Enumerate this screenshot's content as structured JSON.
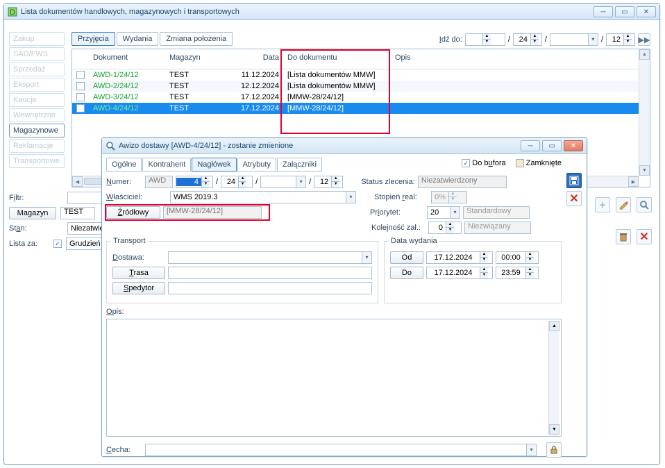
{
  "main": {
    "title": "Lista dokumentów handlowych, magazynowych i transportowych",
    "sidetabs": [
      "Zakup",
      "SAD/FWS",
      "Sprzedaż",
      "Eksport",
      "Kaucje",
      "Wewnętrzne",
      "Magazynowe",
      "Reklamacje",
      "Transportowe"
    ],
    "sidetab_active_index": 6,
    "toptabs": [
      "Przyjęcia",
      "Wydania",
      "Zmiana położenia"
    ],
    "toptab_active_index": 0,
    "goto_label": "Idź do:",
    "goto_seg2": "24",
    "goto_seg4": "12",
    "columns": [
      "Dokument",
      "Magazyn",
      "Data",
      "Do dokumentu",
      "Opis"
    ],
    "rows": [
      {
        "doc": "AWD-1/24/12",
        "mag": "TEST",
        "date": "11.12.2024",
        "ref": "[Lista dokumentów MMW]"
      },
      {
        "doc": "AWD-2/24/12",
        "mag": "TEST",
        "date": "12.12.2024",
        "ref": "[Lista dokumentów MMW]"
      },
      {
        "doc": "AWD-3/24/12",
        "mag": "TEST",
        "date": "17.12.2024",
        "ref": "[MMW-28/24/12]"
      },
      {
        "doc": "AWD-4/24/12",
        "mag": "TEST",
        "date": "17.12.2024",
        "ref": "[MMW-28/24/12]"
      }
    ],
    "filtr_label": "Filtr:",
    "magazyn_btn": "Magazyn",
    "magazyn_val": "TEST",
    "stan_label": "Stan:",
    "stan_val": "Niezatwierdzone",
    "lista_label": "Lista za:",
    "lista_val": "Grudzień"
  },
  "modal": {
    "title": "Awizo dostawy [AWD-4/24/12]  - zostanie zmienione",
    "tabs": [
      "Ogólne",
      "Kontrahent",
      "Nagłówek",
      "Atrybuty",
      "Załączniki"
    ],
    "tab_active_index": 2,
    "do_bufora": "Do bufora",
    "do_bufora_checked": true,
    "zamkniete": "Zamknięte",
    "zamkniete_checked": false,
    "numer_label": "Numer:",
    "numer_prefix": "AWD",
    "numer_n": "4",
    "numer_seg2": "24",
    "numer_seg4": "12",
    "wlasciciel_label": "Właściciel:",
    "wlasciciel_val": "WMS 2019.3",
    "zrodlowy_btn": "Źródłowy",
    "zrodlowy_val": "[MMW-28/24/12]",
    "status_label": "Status zlecenia:",
    "status_val": "Niezatwierdzony",
    "stopien_label": "Stopień real:",
    "stopien_val": "0%",
    "priorytet_label": "Priorytet:",
    "priorytet_val": "20",
    "priorytet_txt": "Standardowy",
    "kolejnosc_label": "Kolejność zał.:",
    "kolejnosc_val": "0",
    "kolejnosc_txt": "Niezwiązany",
    "transport_legend": "Transport",
    "dostawa_label": "Dostawa:",
    "trasa_btn": "Trasa",
    "spedytor_btn": "Spedytor",
    "datawyd_legend": "Data wydania",
    "od_btn": "Od",
    "do_btn": "Do",
    "od_date": "17.12.2024",
    "od_time": "00:00",
    "do_date": "17.12.2024",
    "do_time": "23:59",
    "opis_label": "Opis:",
    "cecha_label": "Cecha:"
  }
}
